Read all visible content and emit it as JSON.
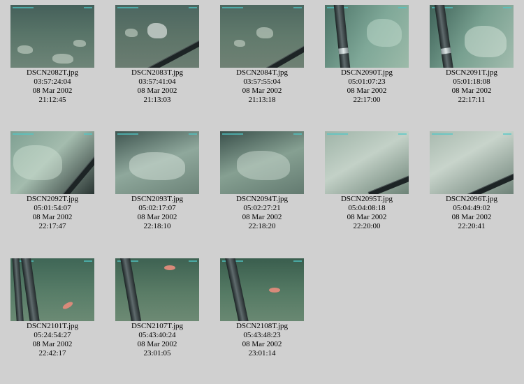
{
  "thumbnails": [
    {
      "filename": "DSCN2082T.jpg",
      "timecode": "03:57:24:04",
      "date": "08 Mar 2002",
      "time": "21:12:45"
    },
    {
      "filename": "DSCN2083T.jpg",
      "timecode": "03:57:41:04",
      "date": "08 Mar 2002",
      "time": "21:13:03"
    },
    {
      "filename": "DSCN2084T.jpg",
      "timecode": "03:57:55:04",
      "date": "08 Mar 2002",
      "time": "21:13:18"
    },
    {
      "filename": "DSCN2090T.jpg",
      "timecode": "05:01:07:23",
      "date": "08 Mar 2002",
      "time": "22:17:00"
    },
    {
      "filename": "DSCN2091T.jpg",
      "timecode": "05:01:18:08",
      "date": "08 Mar 2002",
      "time": "22:17:11"
    },
    {
      "filename": "DSCN2092T.jpg",
      "timecode": "05:01:54:07",
      "date": "08 Mar 2002",
      "time": "22:17:47"
    },
    {
      "filename": "DSCN2093T.jpg",
      "timecode": "05:02:17:07",
      "date": "08 Mar 2002",
      "time": "22:18:10"
    },
    {
      "filename": "DSCN2094T.jpg",
      "timecode": "05:02:27:21",
      "date": "08 Mar 2002",
      "time": "22:18:20"
    },
    {
      "filename": "DSCN2095T.jpg",
      "timecode": "05:04:08:18",
      "date": "08 Mar 2002",
      "time": "22:20:00"
    },
    {
      "filename": "DSCN2096T.jpg",
      "timecode": "05:04:49:02",
      "date": "08 Mar 2002",
      "time": "22:20:41"
    },
    {
      "filename": "DSCN2101T.jpg",
      "timecode": "05:24:54:27",
      "date": "08 Mar 2002",
      "time": "22:42:17"
    },
    {
      "filename": "DSCN2107T.jpg",
      "timecode": "05:43:40:24",
      "date": "08 Mar 2002",
      "time": "23:01:05"
    },
    {
      "filename": "DSCN2108T.jpg",
      "timecode": "05:43:48:23",
      "date": "08 Mar 2002",
      "time": "23:01:14"
    }
  ],
  "colors": {
    "background": "#d0d0d0",
    "seafloor_green": "#5f7f70",
    "rock_pale": "#c8d2c8"
  }
}
